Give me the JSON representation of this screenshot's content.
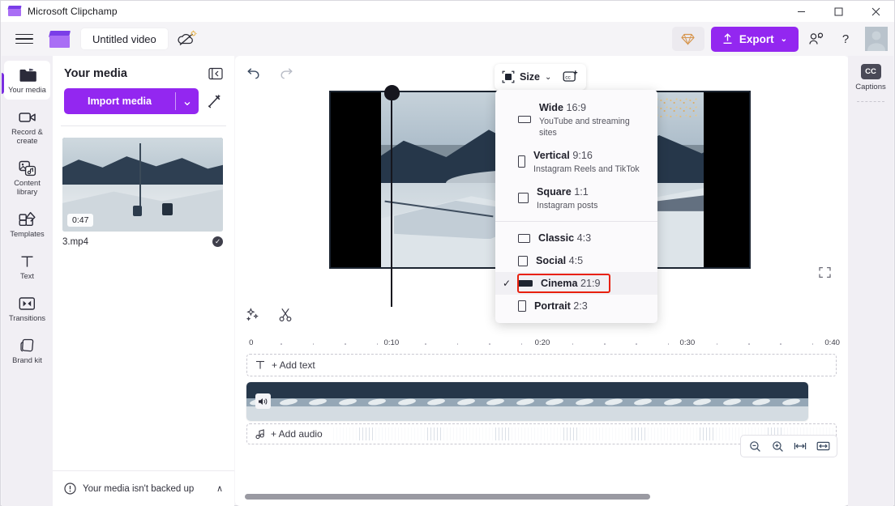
{
  "window": {
    "title": "Microsoft Clipchamp",
    "app_icon": "clapperboard-icon",
    "minimize": "–",
    "maximize": "☐",
    "close": "✕"
  },
  "toolbar": {
    "menu_icon": "hamburger-menu-icon",
    "logo_icon": "clapperboard-logo-icon",
    "project_title": "Untitled video",
    "cloud_status_icon": "cloud-off-icon",
    "premium_icon": "diamond-icon",
    "export_label": "Export",
    "export_icon": "upload-arrow-icon",
    "export_caret": "⌄",
    "share_icon": "people-share-icon",
    "help_label": "?",
    "avatar_icon": "user-avatar"
  },
  "sidebar": {
    "items": [
      {
        "label": "Your media",
        "icon": "folder-icon",
        "active": true
      },
      {
        "label": "Record & create",
        "icon": "video-camera-icon",
        "active": false
      },
      {
        "label": "Content library",
        "icon": "content-library-icon",
        "active": false
      },
      {
        "label": "Templates",
        "icon": "templates-grid-icon",
        "active": false
      },
      {
        "label": "Text",
        "icon": "text-t-icon",
        "active": false
      },
      {
        "label": "Transitions",
        "icon": "transitions-icon",
        "active": false
      },
      {
        "label": "Brand kit",
        "icon": "brand-kit-icon",
        "active": false
      }
    ]
  },
  "media_panel": {
    "title": "Your media",
    "collapse_icon": "collapse-panel-icon",
    "import_label": "Import media",
    "import_caret": "⌄",
    "magic_icon": "magic-wand-icon",
    "items": [
      {
        "name": "3.mp4",
        "duration": "0:47",
        "badge_icon": "checkmark-circle-icon"
      }
    ],
    "footer": {
      "icon": "warning-circle-icon",
      "text": "Your media isn't backed up",
      "caret": "∧"
    }
  },
  "stage": {
    "undo_icon": "undo-arrow-icon",
    "redo_icon": "redo-arrow-icon",
    "size_button_label": "Size",
    "size_button_icon": "crop-size-icon",
    "size_button_caret": "⌄",
    "add_captions_icon": "cc-add-icon",
    "fullscreen_icon": "fullscreen-icon"
  },
  "size_dropdown": {
    "highlighted_option": "Cinema 21:9",
    "highlight_color": "#e8200d",
    "check_glyph": "✓",
    "groups": [
      {
        "items": [
          {
            "name": "Wide",
            "ratio": "16:9",
            "sub": "YouTube and streaming sites",
            "icon": "rect-16-9-icon",
            "selected": false
          },
          {
            "name": "Vertical",
            "ratio": "9:16",
            "sub": "Instagram Reels and TikTok",
            "icon": "rect-9-16-icon",
            "selected": false
          },
          {
            "name": "Square",
            "ratio": "1:1",
            "sub": "Instagram posts",
            "icon": "rect-1-1-icon",
            "selected": false
          }
        ]
      },
      {
        "items": [
          {
            "name": "Classic",
            "ratio": "4:3",
            "sub": "",
            "icon": "rect-4-3-icon",
            "selected": false
          },
          {
            "name": "Social",
            "ratio": "4:5",
            "sub": "",
            "icon": "rect-4-5-icon",
            "selected": false
          },
          {
            "name": "Cinema",
            "ratio": "21:9",
            "sub": "",
            "icon": "rect-21-9-icon",
            "selected": true
          },
          {
            "name": "Portrait",
            "ratio": "2:3",
            "sub": "",
            "icon": "rect-2-3-icon",
            "selected": false
          }
        ]
      }
    ]
  },
  "timeline": {
    "tools": [
      {
        "icon": "magic-sparkle-icon",
        "name": "auto-compose"
      },
      {
        "icon": "scissors-icon",
        "name": "split"
      }
    ],
    "ruler_labels": [
      "0",
      "0:10",
      "0:20",
      "0:30",
      "0:40"
    ],
    "ruler_positions_pct": [
      0,
      24.5,
      50,
      74.5,
      99
    ],
    "playhead_time": "0:11",
    "text_track": {
      "icon": "text-t-icon",
      "label": "+ Add text"
    },
    "audio_track": {
      "icon": "music-note-icon",
      "label": "+ Add audio"
    },
    "video_clip": {
      "mute_icon": "speaker-icon",
      "frames": 19
    },
    "zoom_controls": [
      {
        "icon": "zoom-out-icon",
        "name": "zoom-out"
      },
      {
        "icon": "zoom-in-icon",
        "name": "zoom-in"
      },
      {
        "icon": "fit-width-icon",
        "name": "fit-to-width"
      },
      {
        "icon": "fit-screen-icon",
        "name": "fit-to-screen"
      }
    ]
  },
  "right_rail": {
    "items": [
      {
        "label": "Captions",
        "icon": "cc-icon",
        "badge": "CC"
      }
    ]
  },
  "colors": {
    "brand_purple": "#9327f0",
    "accent_purple": "#7a2ee0",
    "highlight_red": "#e8200d",
    "panel_bg": "#f1eff4",
    "window_bg": "#f5f4f7"
  }
}
